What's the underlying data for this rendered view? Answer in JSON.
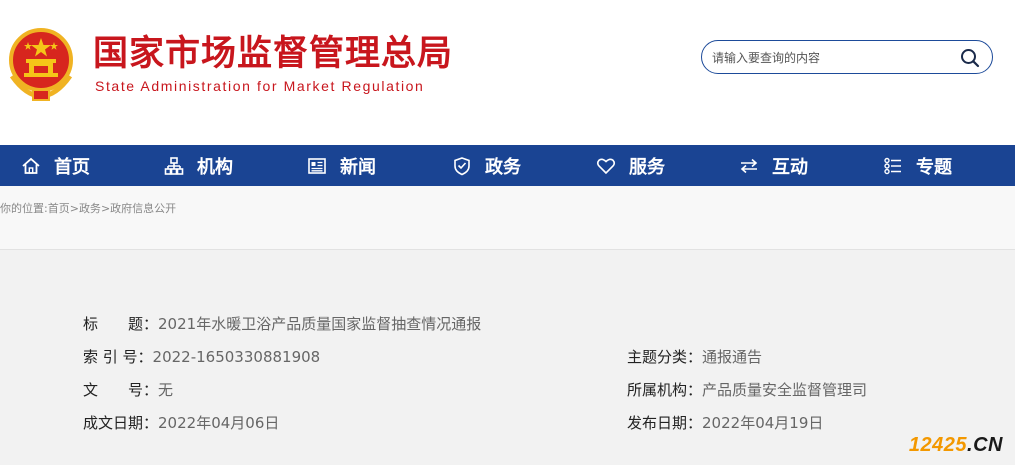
{
  "header": {
    "title": "国家市场监督管理总局",
    "subtitle": "State Administration for Market Regulation",
    "search_placeholder": "请输入要查询的内容"
  },
  "nav": {
    "items": [
      {
        "label": "首页",
        "icon": "home-icon"
      },
      {
        "label": "机构",
        "icon": "org-chart-icon"
      },
      {
        "label": "新闻",
        "icon": "newspaper-icon"
      },
      {
        "label": "政务",
        "icon": "shield-icon"
      },
      {
        "label": "服务",
        "icon": "heart-icon"
      },
      {
        "label": "互动",
        "icon": "swap-arrows-icon"
      },
      {
        "label": "专题",
        "icon": "topics-list-icon"
      }
    ]
  },
  "breadcrumb": {
    "prefix": "你的位置:",
    "items": [
      "首页",
      "政务",
      "政府信息公开"
    ],
    "separator": ">"
  },
  "info": {
    "title_label": "标　　题：",
    "title_value": "2021年水暖卫浴产品质量国家监督抽查情况通报",
    "index_label": "索 引 号：",
    "index_value": "2022-1650330881908",
    "doc_label": "文　　号：",
    "doc_value": "无",
    "made_label": "成文日期：",
    "made_value": "2022年04月06日",
    "category_label": "主题分类：",
    "category_value": "通报通告",
    "dept_label": "所属机构：",
    "dept_value": "产品质量安全监督管理司",
    "pub_label": "发布日期：",
    "pub_value": "2022年04月19日"
  },
  "watermark": {
    "number": "12425",
    "suffix": ".CN",
    "number_color": "#f39800",
    "suffix_color": "#1a1a1a"
  },
  "colors": {
    "brand_red": "#c8161d",
    "nav_blue": "#1a4493"
  }
}
